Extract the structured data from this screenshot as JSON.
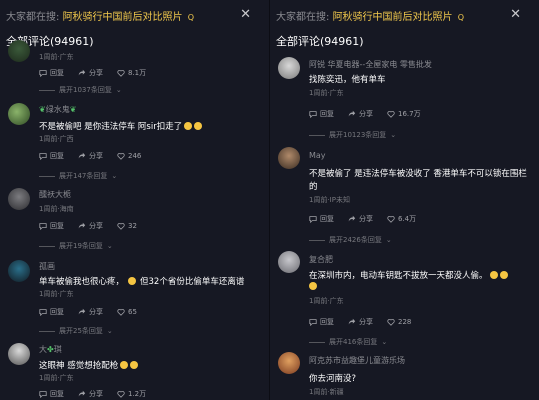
{
  "left": {
    "search": {
      "prefix": "大家都在搜:",
      "query": "阿秋骑行中国前后对比照片",
      "hint": "Q"
    },
    "title": "全部评论(94961)",
    "comments": [
      {
        "user": "",
        "text": "",
        "meta": "1周前·广东",
        "share": "分享",
        "likes": "8.1万",
        "reply": "回复",
        "expand": "展开1037条回复"
      },
      {
        "user": "绿水鬼",
        "text": "不是被偷吧 是你违法停车 阿sir扣走了",
        "meta": "1周前·广西",
        "share": "分享",
        "likes": "246",
        "reply": "回复",
        "expand": "展开147条回复"
      },
      {
        "user": "醺祆大栀",
        "text": "",
        "meta": "1周前·海南",
        "share": "分享",
        "likes": "32",
        "reply": "回复",
        "expand": "展开19条回复"
      },
      {
        "user": "孤画",
        "text": "单车被偷我也很心疼，",
        "text2": "但32个省份比偷单车还离谱",
        "meta": "1周前·广东",
        "share": "分享",
        "likes": "65",
        "reply": "回复",
        "expand": "展开25条回复"
      },
      {
        "user": "大",
        "user2": "琪",
        "text": "这眼神 感觉想抢配枪",
        "meta": "1周前·广东",
        "share": "分享",
        "likes": "1.2万",
        "reply": "回复"
      }
    ]
  },
  "right": {
    "search": {
      "prefix": "大家都在搜:",
      "query": "阿秋骑行中国前后对比照片",
      "hint": "Q"
    },
    "title": "全部评论(94961)",
    "comments": [
      {
        "user": "阿锐 华夏电器--全屋家电 零售批发",
        "text": "找陈奕迅，他有单车",
        "meta": "1周前·广东",
        "share": "分享",
        "likes": "16.7万",
        "reply": "回复",
        "expand": "展开10123条回复"
      },
      {
        "user": "May",
        "text": "不是被偷了 是违法停车被没收了 香港单车不可以锁在围栏",
        "text2": "的",
        "meta": "1周前·IP未知",
        "share": "分享",
        "likes": "6.4万",
        "reply": "回复",
        "expand": "展开2426条回复"
      },
      {
        "user": "复合肥",
        "text": "在深圳市内，电动车钥匙不拔放一天都没人偷。",
        "meta": "1周前·广东",
        "share": "分享",
        "likes": "228",
        "reply": "回复",
        "expand": "展开416条回复"
      },
      {
        "user": "阿克苏市益趣堡儿童游乐场",
        "text": "你去河南没?",
        "meta": "1周前·新疆"
      }
    ]
  },
  "colors": {
    "background": "#161823",
    "accent": "#f2c94c",
    "muted": "#8a8b91"
  },
  "icons": [
    "close-icon",
    "share-icon",
    "like-icon",
    "reply-icon",
    "chevron-down-icon"
  ]
}
